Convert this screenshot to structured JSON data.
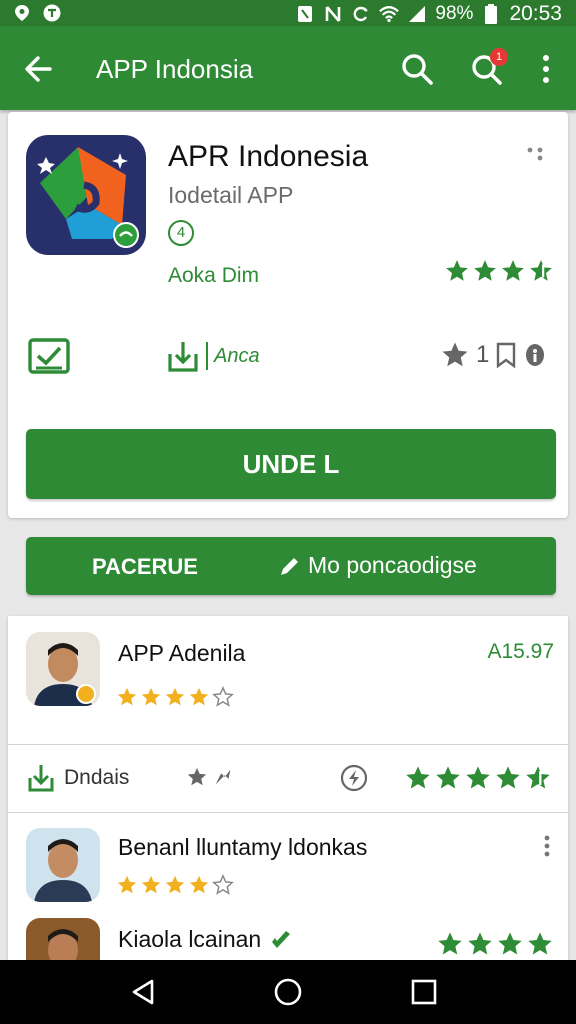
{
  "status_bar": {
    "battery": "98%",
    "time": "20:53",
    "icons": [
      "location-icon",
      "notification-icon",
      "nfc-icon",
      "sync-icon",
      "wifi-icon",
      "signal-icon",
      "battery-icon"
    ]
  },
  "app_bar": {
    "title": "APP Indonsia",
    "badge": "1",
    "icons": [
      "back-arrow-icon",
      "search-icon",
      "search-notification-icon",
      "more-vert-icon"
    ]
  },
  "app": {
    "name": "APR Indonesia",
    "subtitle": "Iodetail APP",
    "age_rating": "4",
    "developer_label": "Aoka Dim",
    "rating_stars": 3.5,
    "rating_count_label": "1",
    "install_label": "Anca"
  },
  "buttons": {
    "install": "UNDE L",
    "action_left": "PACERUE",
    "action_right": "Mo poncaodigse"
  },
  "list": [
    {
      "title": "APP Adenila",
      "stars": 4,
      "price": "A15.97"
    },
    {
      "title": "Benanl lluntamy ldonkas",
      "stars": 4
    },
    {
      "title": "Kiaola lcainan",
      "stars": 4
    }
  ],
  "meta": {
    "download_label": "Dndais",
    "rating_stars": 4.5
  },
  "colors": {
    "primary": "#2f8a35",
    "status_bar": "#2b7a2e",
    "star_green": "#2e8b36",
    "star_gold": "#f2b01e",
    "background": "#e6e7e6"
  }
}
